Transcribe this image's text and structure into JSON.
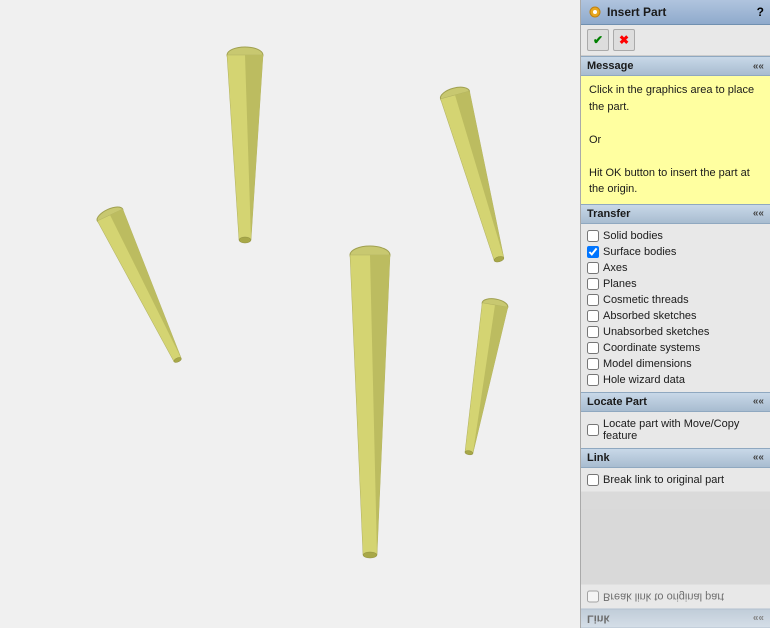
{
  "panel": {
    "title": "Insert Part",
    "help": "?",
    "ok_label": "✔",
    "cancel_label": "✖",
    "message_section": {
      "label": "Message",
      "text_lines": [
        "Click in the graphics area to place the part.",
        "",
        "Or",
        "",
        "Hit OK button to insert the part at the origin."
      ]
    },
    "transfer_section": {
      "label": "Transfer",
      "items": [
        {
          "label": "Solid bodies",
          "checked": false
        },
        {
          "label": "Surface bodies",
          "checked": true
        },
        {
          "label": "Axes",
          "checked": false
        },
        {
          "label": "Planes",
          "checked": false
        },
        {
          "label": "Cosmetic threads",
          "checked": false
        },
        {
          "label": "Absorbed sketches",
          "checked": false
        },
        {
          "label": "Unabsorbed sketches",
          "checked": false
        },
        {
          "label": "Coordinate systems",
          "checked": false
        },
        {
          "label": "Model dimensions",
          "checked": false
        },
        {
          "label": "Hole wizard data",
          "checked": false
        }
      ]
    },
    "locate_section": {
      "label": "Locate Part",
      "items": [
        {
          "label": "Locate part with Move/Copy feature",
          "checked": false
        }
      ]
    },
    "link_section": {
      "label": "Link",
      "items": [
        {
          "label": "Break link to original part",
          "checked": false
        }
      ]
    },
    "flipped_link_label": "Break link to original part",
    "flipped_link_section_label": "Link"
  }
}
